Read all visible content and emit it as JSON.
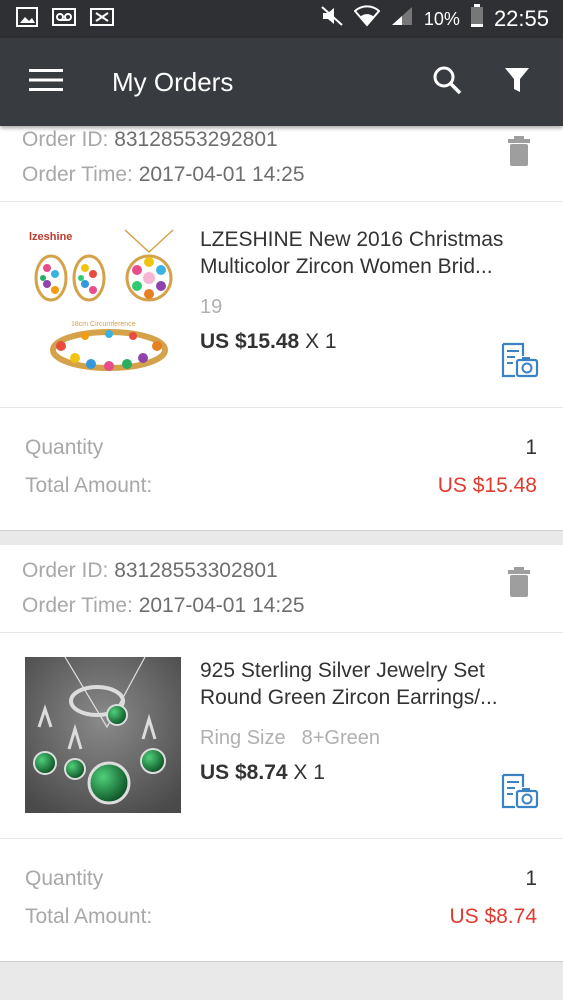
{
  "status_bar": {
    "battery_percent": "10%",
    "time": "22:55",
    "icons": [
      "image-icon",
      "voicemail-icon",
      "close-box-icon",
      "mute-icon",
      "wifi-icon",
      "signal-icon",
      "battery-icon"
    ]
  },
  "app_bar": {
    "title": "My Orders",
    "icons": [
      "menu-icon",
      "search-icon",
      "filter-icon"
    ]
  },
  "labels": {
    "order_id": "Order ID: ",
    "order_time": "Order Time: ",
    "quantity": "Quantity",
    "total_amount": "Total Amount:"
  },
  "orders": [
    {
      "order_id": "83128553292801",
      "order_time": "2017-04-01 14:25",
      "product_title_line1": "LZESHINE New 2016 Christmas",
      "product_title_line2": "Multicolor Zircon Women Brid...",
      "attr_label": "",
      "attr_value": "19",
      "price": "US $15.48",
      "multiplier": "X 1",
      "quantity": "1",
      "total": "US $15.48",
      "image_brand_text": "lzeshine",
      "image_caption": "18cm Circumference"
    },
    {
      "order_id": "83128553302801",
      "order_time": "2017-04-01 14:25",
      "product_title_line1": "925 Sterling Silver Jewelry Set",
      "product_title_line2": "Round Green Zircon Earrings/...",
      "attr_label": "Ring Size",
      "attr_value": "8+Green",
      "price": "US $8.74",
      "multiplier": "X 1",
      "quantity": "1",
      "total": "US $8.74"
    }
  ],
  "colors": {
    "status_bar": "#2e3033",
    "app_bar": "#383c40",
    "price_red": "#e03b2e",
    "icon_blue": "#3b82c4"
  }
}
